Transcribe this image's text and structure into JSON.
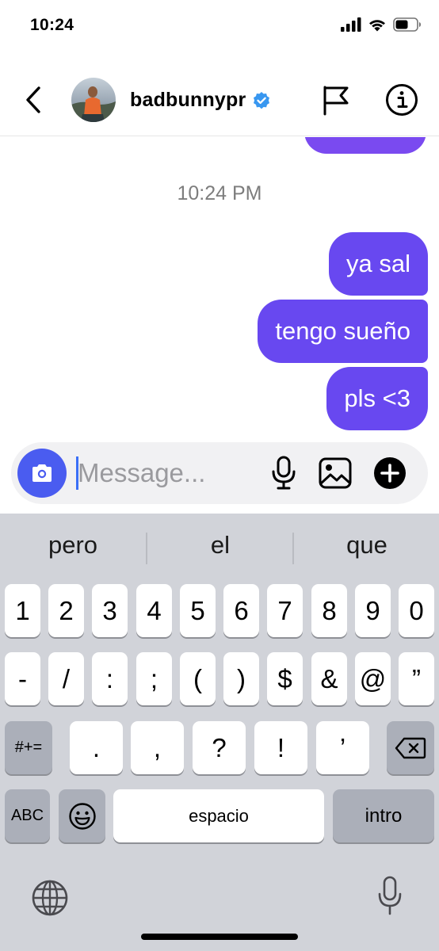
{
  "status_bar": {
    "time": "10:24"
  },
  "header": {
    "username": "badbunnypr"
  },
  "chat": {
    "timestamp": "10:24 PM",
    "messages": [
      "ya sal",
      "tengo sueño",
      "pls <3"
    ]
  },
  "composer": {
    "placeholder": "Message..."
  },
  "keyboard": {
    "suggestions": [
      "pero",
      "el",
      "que"
    ],
    "row1": [
      "1",
      "2",
      "3",
      "4",
      "5",
      "6",
      "7",
      "8",
      "9",
      "0"
    ],
    "row2": [
      "-",
      "/",
      ":",
      ";",
      "(",
      ")",
      "$",
      "&",
      "@",
      "”"
    ],
    "row3": {
      "shift": "#+=",
      "keys": [
        ".",
        ",",
        "?",
        "!",
        "’"
      ]
    },
    "row4": {
      "abc": "ABC",
      "space": "espacio",
      "return": "intro"
    }
  },
  "colors": {
    "bubble": "#6848f0",
    "camera": "#4a5cf0",
    "verified": "#3897f0"
  }
}
